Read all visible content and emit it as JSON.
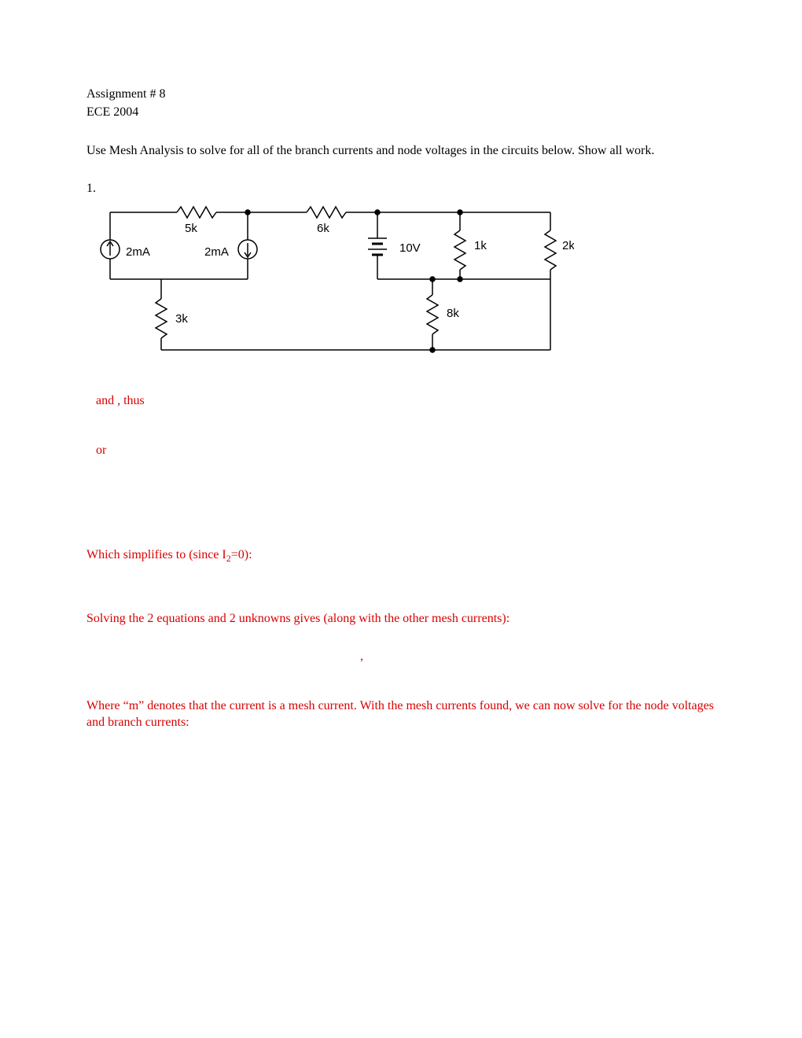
{
  "header": {
    "assignment": "Assignment # 8",
    "course": "ECE 2004"
  },
  "instructions": "Use Mesh Analysis to solve for all of the branch currents and node voltages in the circuits below.  Show all work.",
  "q1": {
    "number": "1."
  },
  "circuit": {
    "r5k": "5k",
    "r6k": "6k",
    "r1k": "1k",
    "r2k": "2k",
    "r3k": "3k",
    "r8k": "8k",
    "i2ma_left": "2mA",
    "i2ma_right": "2mA",
    "v10": "10V"
  },
  "solution": {
    "and_thus": " and  , thus",
    "or": " or",
    "simplifies_pre": "Which simplifies to (since I",
    "simplifies_sub": "2",
    "simplifies_post": "=0):",
    "solving": "Solving the 2 equations and 2 unknowns gives (along with the other mesh currents):",
    "comma": ",",
    "where_m": "Where “m” denotes that the current is a mesh current. With the mesh currents found, we can now solve for the node voltages and branch currents:"
  }
}
